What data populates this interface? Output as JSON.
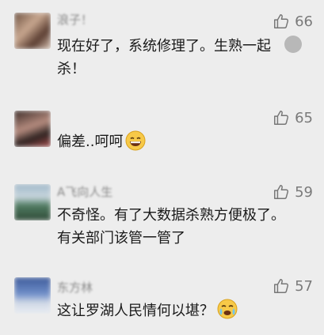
{
  "comments": [
    {
      "name": "浪子！",
      "text": "现在好了，系统修理了。生熟一起杀！",
      "likes": "66",
      "icon": "thumbs-up-icon"
    },
    {
      "name": "",
      "text": "偏差..呵呵",
      "likes": "65",
      "icon": "thumbs-up-icon",
      "emoji": "grinning-face-icon"
    },
    {
      "name": "A飞向人生",
      "text": "不奇怪。有了大数据杀熟方便极了。有关部门该管一管了",
      "likes": "59",
      "icon": "thumbs-up-icon"
    },
    {
      "name": "东方林",
      "text": "这让罗湖人民情何以堪？",
      "likes": "57",
      "icon": "thumbs-up-icon",
      "emoji": "crying-face-icon"
    }
  ]
}
